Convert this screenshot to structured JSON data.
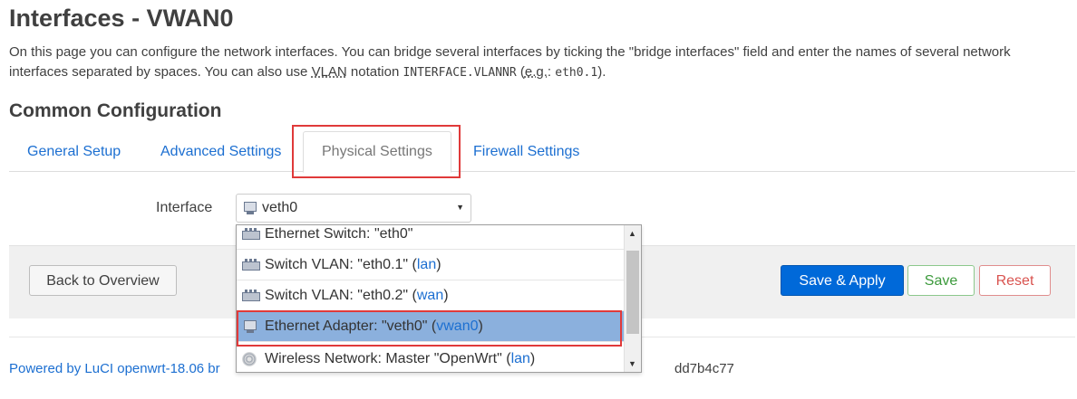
{
  "page": {
    "title": "Interfaces - VWAN0",
    "desc_part1": "On this page you can configure the network interfaces. You can bridge several interfaces by ticking the \"bridge interfaces\" field and enter the names of several network interfaces separated by spaces. You can also use ",
    "desc_vlan": "VLAN",
    "desc_part2": " notation ",
    "desc_code1": "INTERFACE.VLANNR",
    "desc_part3": " (",
    "desc_eg": "e.g.",
    "desc_part4": ": ",
    "desc_code2": "eth0.1",
    "desc_part5": ")."
  },
  "section": {
    "title": "Common Configuration"
  },
  "tabs": [
    {
      "label": "General Setup"
    },
    {
      "label": "Advanced Settings"
    },
    {
      "label": "Physical Settings",
      "active": true
    },
    {
      "label": "Firewall Settings"
    }
  ],
  "interface_field": {
    "label": "Interface",
    "value": "veth0"
  },
  "dropdown": {
    "options": [
      {
        "label": "Ethernet Switch: \"eth0\"",
        "zone": "",
        "icon": "switch-icon"
      },
      {
        "label": "Switch VLAN: \"eth0.1\" (",
        "zone": "lan",
        "suffix": ")",
        "icon": "switch-icon"
      },
      {
        "label": "Switch VLAN: \"eth0.2\" (",
        "zone": "wan",
        "suffix": ")",
        "icon": "switch-icon"
      },
      {
        "label": "Ethernet Adapter: \"veth0\" (",
        "zone": "vwan0",
        "suffix": ")",
        "icon": "ethernet-icon",
        "selected": true
      },
      {
        "label": "Wireless Network: Master \"OpenWrt\" (",
        "zone": "lan",
        "suffix": ")",
        "icon": "wireless-icon"
      }
    ]
  },
  "buttons": {
    "back": "Back to Overview",
    "save_apply": "Save & Apply",
    "save": "Save",
    "reset": "Reset"
  },
  "footer": {
    "text": "Powered by LuCI openwrt-18.06 br",
    "tail": "dd7b4c77"
  },
  "colors": {
    "link": "#1c6fd1",
    "primary": "#0069d9",
    "highlight_border": "#e03a3a",
    "selected_option": "#8bb0dd"
  }
}
